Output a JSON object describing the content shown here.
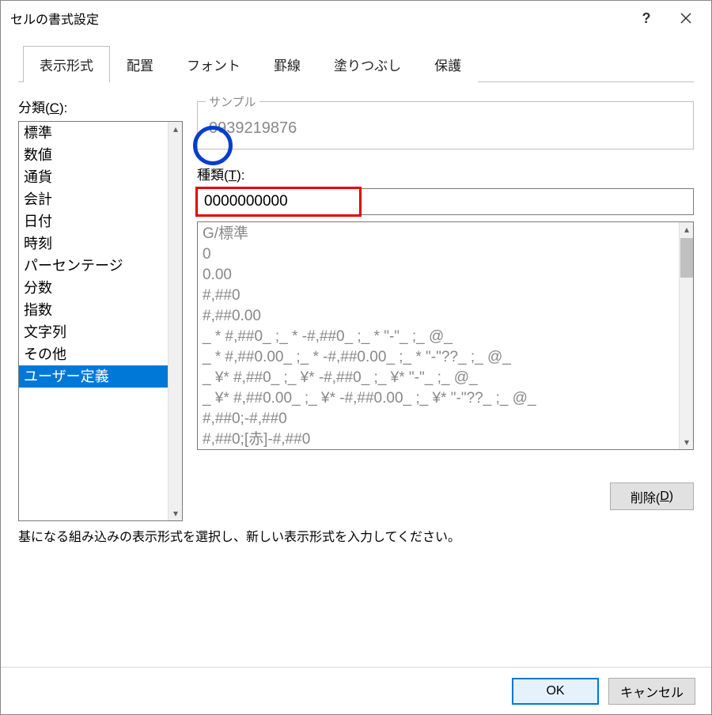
{
  "window": {
    "title": "セルの書式設定"
  },
  "tabs": [
    {
      "label": "表示形式"
    },
    {
      "label": "配置"
    },
    {
      "label": "フォント"
    },
    {
      "label": "罫線"
    },
    {
      "label": "塗りつぶし"
    },
    {
      "label": "保護"
    }
  ],
  "category": {
    "label_prefix": "分類(",
    "label_key": "C",
    "label_suffix": "):",
    "items": [
      "標準",
      "数値",
      "通貨",
      "会計",
      "日付",
      "時刻",
      "パーセンテージ",
      "分数",
      "指数",
      "文字列",
      "その他",
      "ユーザー定義"
    ],
    "selected_index": 11
  },
  "sample": {
    "label": "サンプル",
    "value": "0939219876"
  },
  "type": {
    "label_prefix": "種類(",
    "label_key": "T",
    "label_suffix": "):",
    "value": "0000000000"
  },
  "format_list": [
    "G/標準",
    "0",
    "0.00",
    "#,##0",
    "#,##0.00",
    "_ * #,##0_ ;_ * -#,##0_ ;_ * \"-\"_ ;_ @_",
    "_ * #,##0.00_ ;_ * -#,##0.00_ ;_ * \"-\"??_ ;_ @_",
    "_ ¥* #,##0_ ;_ ¥* -#,##0_ ;_ ¥* \"-\"_ ;_ @_",
    "_ ¥* #,##0.00_ ;_ ¥* -#,##0.00_ ;_ ¥* \"-\"??_ ;_ @_",
    "#,##0;-#,##0",
    "#,##0;[赤]-#,##0"
  ],
  "delete": {
    "label_prefix": "削除(",
    "label_key": "D",
    "label_suffix": ")"
  },
  "helptext": "基になる組み込みの表示形式を選択し、新しい表示形式を入力してください。",
  "buttons": {
    "ok": "OK",
    "cancel": "キャンセル"
  }
}
